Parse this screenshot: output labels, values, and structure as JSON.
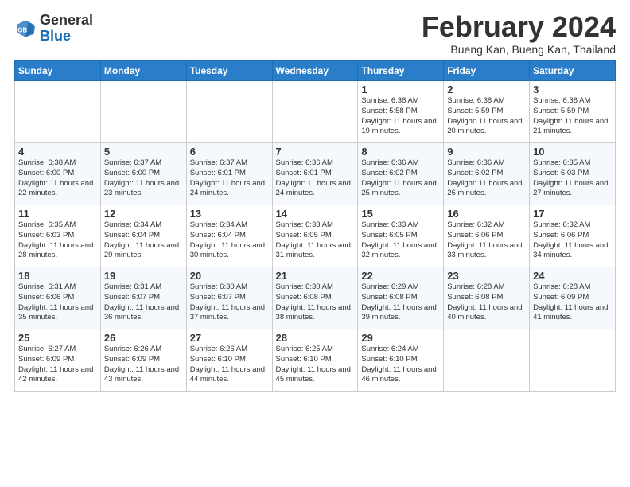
{
  "header": {
    "logo_general": "General",
    "logo_blue": "Blue",
    "month_title": "February 2024",
    "location": "Bueng Kan, Bueng Kan, Thailand"
  },
  "weekdays": [
    "Sunday",
    "Monday",
    "Tuesday",
    "Wednesday",
    "Thursday",
    "Friday",
    "Saturday"
  ],
  "weeks": [
    [
      {
        "day": "",
        "info": ""
      },
      {
        "day": "",
        "info": ""
      },
      {
        "day": "",
        "info": ""
      },
      {
        "day": "",
        "info": ""
      },
      {
        "day": "1",
        "info": "Sunrise: 6:38 AM\nSunset: 5:58 PM\nDaylight: 11 hours\nand 19 minutes."
      },
      {
        "day": "2",
        "info": "Sunrise: 6:38 AM\nSunset: 5:59 PM\nDaylight: 11 hours\nand 20 minutes."
      },
      {
        "day": "3",
        "info": "Sunrise: 6:38 AM\nSunset: 5:59 PM\nDaylight: 11 hours\nand 21 minutes."
      }
    ],
    [
      {
        "day": "4",
        "info": "Sunrise: 6:38 AM\nSunset: 6:00 PM\nDaylight: 11 hours\nand 22 minutes."
      },
      {
        "day": "5",
        "info": "Sunrise: 6:37 AM\nSunset: 6:00 PM\nDaylight: 11 hours\nand 23 minutes."
      },
      {
        "day": "6",
        "info": "Sunrise: 6:37 AM\nSunset: 6:01 PM\nDaylight: 11 hours\nand 24 minutes."
      },
      {
        "day": "7",
        "info": "Sunrise: 6:36 AM\nSunset: 6:01 PM\nDaylight: 11 hours\nand 24 minutes."
      },
      {
        "day": "8",
        "info": "Sunrise: 6:36 AM\nSunset: 6:02 PM\nDaylight: 11 hours\nand 25 minutes."
      },
      {
        "day": "9",
        "info": "Sunrise: 6:36 AM\nSunset: 6:02 PM\nDaylight: 11 hours\nand 26 minutes."
      },
      {
        "day": "10",
        "info": "Sunrise: 6:35 AM\nSunset: 6:03 PM\nDaylight: 11 hours\nand 27 minutes."
      }
    ],
    [
      {
        "day": "11",
        "info": "Sunrise: 6:35 AM\nSunset: 6:03 PM\nDaylight: 11 hours\nand 28 minutes."
      },
      {
        "day": "12",
        "info": "Sunrise: 6:34 AM\nSunset: 6:04 PM\nDaylight: 11 hours\nand 29 minutes."
      },
      {
        "day": "13",
        "info": "Sunrise: 6:34 AM\nSunset: 6:04 PM\nDaylight: 11 hours\nand 30 minutes."
      },
      {
        "day": "14",
        "info": "Sunrise: 6:33 AM\nSunset: 6:05 PM\nDaylight: 11 hours\nand 31 minutes."
      },
      {
        "day": "15",
        "info": "Sunrise: 6:33 AM\nSunset: 6:05 PM\nDaylight: 11 hours\nand 32 minutes."
      },
      {
        "day": "16",
        "info": "Sunrise: 6:32 AM\nSunset: 6:06 PM\nDaylight: 11 hours\nand 33 minutes."
      },
      {
        "day": "17",
        "info": "Sunrise: 6:32 AM\nSunset: 6:06 PM\nDaylight: 11 hours\nand 34 minutes."
      }
    ],
    [
      {
        "day": "18",
        "info": "Sunrise: 6:31 AM\nSunset: 6:06 PM\nDaylight: 11 hours\nand 35 minutes."
      },
      {
        "day": "19",
        "info": "Sunrise: 6:31 AM\nSunset: 6:07 PM\nDaylight: 11 hours\nand 36 minutes."
      },
      {
        "day": "20",
        "info": "Sunrise: 6:30 AM\nSunset: 6:07 PM\nDaylight: 11 hours\nand 37 minutes."
      },
      {
        "day": "21",
        "info": "Sunrise: 6:30 AM\nSunset: 6:08 PM\nDaylight: 11 hours\nand 38 minutes."
      },
      {
        "day": "22",
        "info": "Sunrise: 6:29 AM\nSunset: 6:08 PM\nDaylight: 11 hours\nand 39 minutes."
      },
      {
        "day": "23",
        "info": "Sunrise: 6:28 AM\nSunset: 6:08 PM\nDaylight: 11 hours\nand 40 minutes."
      },
      {
        "day": "24",
        "info": "Sunrise: 6:28 AM\nSunset: 6:09 PM\nDaylight: 11 hours\nand 41 minutes."
      }
    ],
    [
      {
        "day": "25",
        "info": "Sunrise: 6:27 AM\nSunset: 6:09 PM\nDaylight: 11 hours\nand 42 minutes."
      },
      {
        "day": "26",
        "info": "Sunrise: 6:26 AM\nSunset: 6:09 PM\nDaylight: 11 hours\nand 43 minutes."
      },
      {
        "day": "27",
        "info": "Sunrise: 6:26 AM\nSunset: 6:10 PM\nDaylight: 11 hours\nand 44 minutes."
      },
      {
        "day": "28",
        "info": "Sunrise: 6:25 AM\nSunset: 6:10 PM\nDaylight: 11 hours\nand 45 minutes."
      },
      {
        "day": "29",
        "info": "Sunrise: 6:24 AM\nSunset: 6:10 PM\nDaylight: 11 hours\nand 46 minutes."
      },
      {
        "day": "",
        "info": ""
      },
      {
        "day": "",
        "info": ""
      }
    ]
  ]
}
